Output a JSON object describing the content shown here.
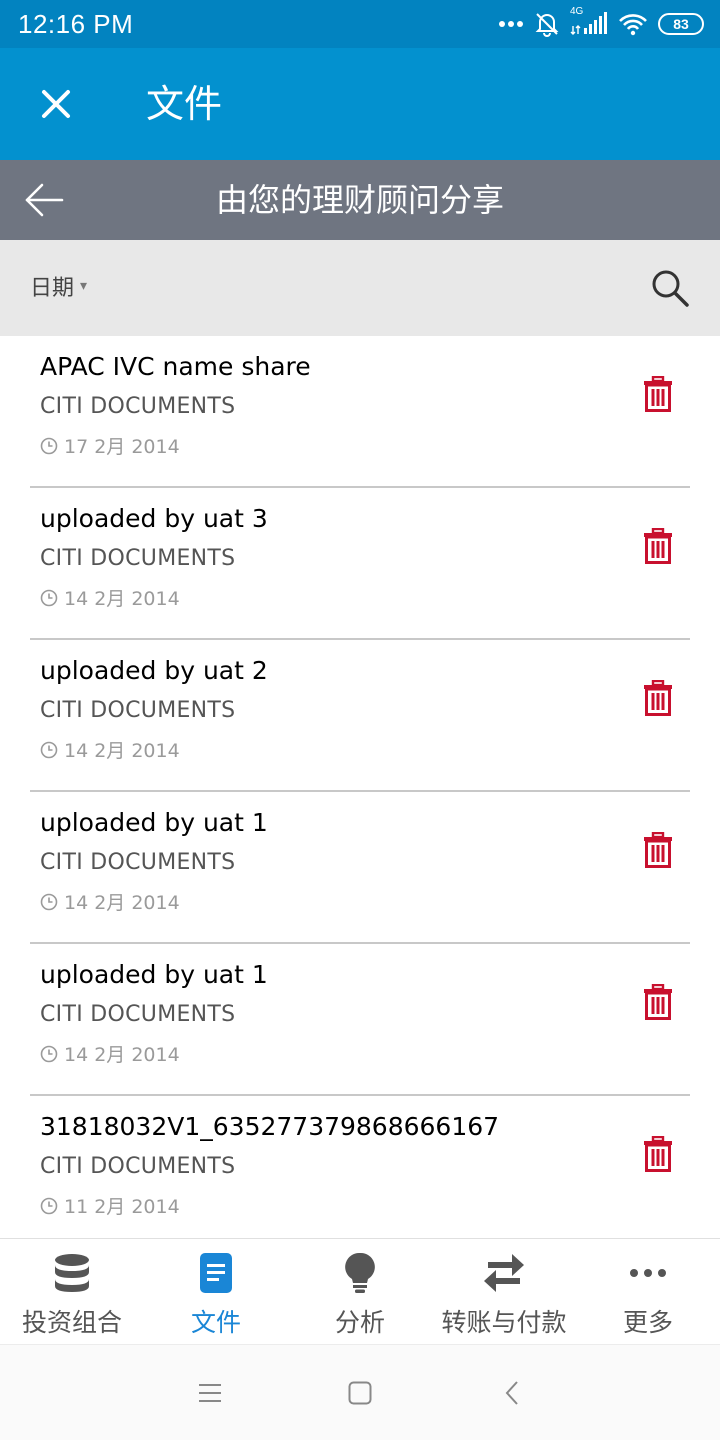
{
  "status_bar": {
    "time": "12:16 PM",
    "network": "4G",
    "battery": "83"
  },
  "app_bar": {
    "title": "文件"
  },
  "sub_header": {
    "title": "由您的理财顾问分享"
  },
  "filter": {
    "sort_label": "日期",
    "sort_caret": "▾"
  },
  "documents": [
    {
      "title": "APAC IVC name share",
      "category": "CITI DOCUMENTS",
      "date": "17 2月 2014"
    },
    {
      "title": "uploaded by uat 3",
      "category": "CITI DOCUMENTS",
      "date": "14 2月 2014"
    },
    {
      "title": "uploaded by uat 2",
      "category": "CITI DOCUMENTS",
      "date": "14 2月 2014"
    },
    {
      "title": "uploaded by uat 1",
      "category": "CITI DOCUMENTS",
      "date": "14 2月 2014"
    },
    {
      "title": "uploaded by uat 1",
      "category": "CITI DOCUMENTS",
      "date": "14 2月 2014"
    },
    {
      "title": "31818032V1_635277379868666167",
      "category": "CITI DOCUMENTS",
      "date": "11 2月 2014"
    }
  ],
  "bottom_nav": [
    {
      "label": "投资组合",
      "icon": "database-icon",
      "active": false
    },
    {
      "label": "文件",
      "icon": "document-icon",
      "active": true
    },
    {
      "label": "分析",
      "icon": "lightbulb-icon",
      "active": false
    },
    {
      "label": "转账与付款",
      "icon": "transfer-arrows-icon",
      "active": false
    },
    {
      "label": "更多",
      "icon": "more-dots-icon",
      "active": false
    }
  ],
  "colors": {
    "status_bar": "#0283c0",
    "app_bar": "#0391cf",
    "sub_header": "#6f7581",
    "filter_bar": "#e8e8e8",
    "delete_red": "#c8102e",
    "nav_active": "#1a86d6",
    "nav_inactive": "#555555"
  }
}
